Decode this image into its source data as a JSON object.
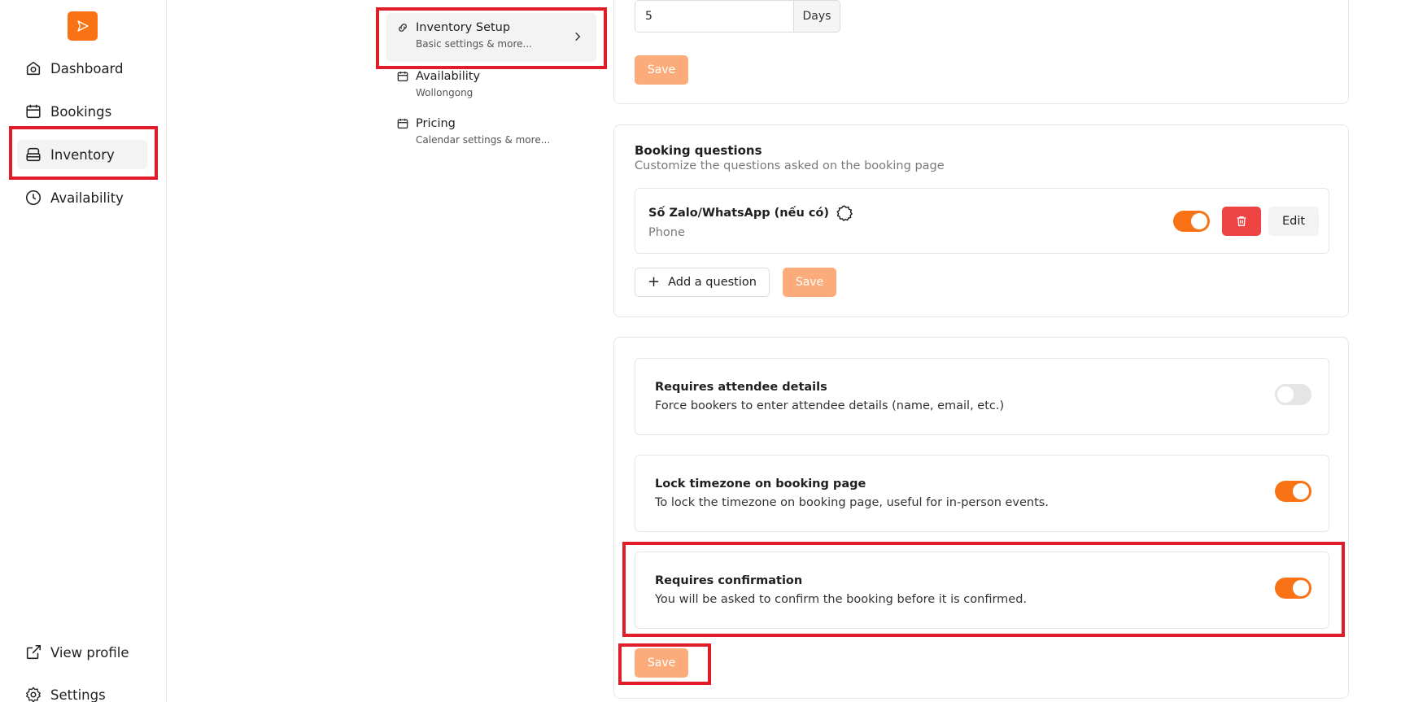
{
  "sidebar": {
    "items": [
      {
        "label": "Dashboard",
        "icon": "dashboard-icon"
      },
      {
        "label": "Bookings",
        "icon": "calendar-icon"
      },
      {
        "label": "Inventory",
        "icon": "inventory-icon"
      },
      {
        "label": "Availability",
        "icon": "clock-icon"
      }
    ],
    "footer": [
      {
        "label": "View profile",
        "icon": "external-link-icon"
      },
      {
        "label": "Settings",
        "icon": "gear-icon"
      }
    ]
  },
  "submenu": [
    {
      "title": "Inventory Setup",
      "subtitle": "Basic settings & more...",
      "icon": "link-icon"
    },
    {
      "title": "Availability",
      "subtitle": "Wollongong",
      "icon": "calendar-icon"
    },
    {
      "title": "Pricing",
      "subtitle": "Calendar settings & more...",
      "icon": "calendar-icon"
    }
  ],
  "top_card": {
    "days_value": "5",
    "days_unit": "Days",
    "save_label": "Save"
  },
  "booking_questions": {
    "title": "Booking questions",
    "subtitle": "Customize the questions asked on the booking page",
    "question": {
      "title": "Số Zalo/WhatsApp (nếu có)",
      "type": "Phone",
      "enabled": true,
      "edit_label": "Edit"
    },
    "add_label": "Add a question",
    "save_label": "Save"
  },
  "options": [
    {
      "title": "Requires attendee details",
      "desc": "Force bookers to enter attendee details (name, email, etc.)",
      "enabled": false
    },
    {
      "title": "Lock timezone on booking page",
      "desc": "To lock the timezone on booking page, useful for in-person events.",
      "enabled": true
    },
    {
      "title": "Requires confirmation",
      "desc": "You will be asked to confirm the booking before it is confirmed.",
      "enabled": true
    }
  ],
  "options_save_label": "Save",
  "colors": {
    "accent": "#f97316",
    "accent_light": "#fbac7a",
    "danger": "#ef4444",
    "highlight": "#e11d2a"
  }
}
